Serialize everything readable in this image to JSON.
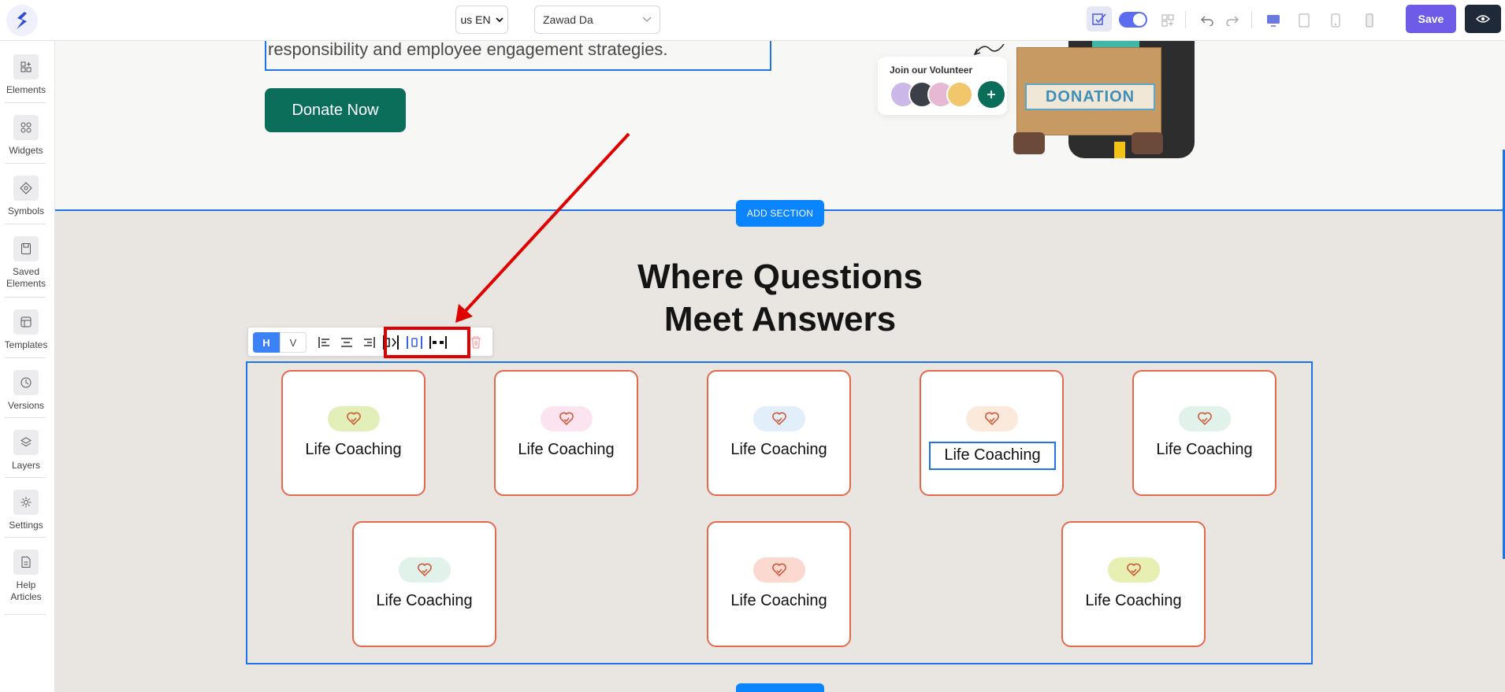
{
  "topbar": {
    "language": "us EN",
    "user_select": "Zawad Da",
    "save_label": "Save"
  },
  "sidebar": {
    "items": [
      {
        "label": "Elements",
        "icon": "elements-icon"
      },
      {
        "label": "Widgets",
        "icon": "widgets-icon"
      },
      {
        "label": "Symbols",
        "icon": "symbols-icon"
      },
      {
        "label": "Saved Elements",
        "icon": "saved-elements-icon"
      },
      {
        "label": "Templates",
        "icon": "templates-icon"
      },
      {
        "label": "Versions",
        "icon": "versions-icon"
      },
      {
        "label": "Layers",
        "icon": "layers-icon"
      },
      {
        "label": "Settings",
        "icon": "settings-icon"
      },
      {
        "label": "Help Articles",
        "icon": "help-articles-icon"
      }
    ]
  },
  "hero": {
    "text": "responsibility and employee engagement strategies.",
    "donate_label": "Donate Now",
    "volunteer_title": "Join our Volunteer",
    "box_label": "DONATION"
  },
  "add_section_label": "ADD SECTION",
  "heading": {
    "line1": "Where Questions",
    "line2": "Meet Answers"
  },
  "toolbar": {
    "h_label": "H",
    "v_label": "V"
  },
  "cards": [
    {
      "label": "Life Coaching",
      "pill_color": "#e3efb8"
    },
    {
      "label": "Life Coaching",
      "pill_color": "#fbe4f0"
    },
    {
      "label": "Life Coaching",
      "pill_color": "#e3eefb"
    },
    {
      "label": "Life Coaching",
      "pill_color": "#fbe9dc"
    },
    {
      "label": "Life Coaching",
      "pill_color": "#e1f2ea"
    },
    {
      "label": "Life Coaching",
      "pill_color": "#e1f2ea"
    },
    {
      "label": "Life Coaching",
      "pill_color": "#fbd9d0"
    },
    {
      "label": "Life Coaching",
      "pill_color": "#e8efb2"
    }
  ],
  "colors": {
    "accent": "#6c5ce7",
    "selection": "#1e73e8",
    "donate": "#0b6e5b",
    "card_border": "#e4694c",
    "annotation": "#e10000"
  }
}
